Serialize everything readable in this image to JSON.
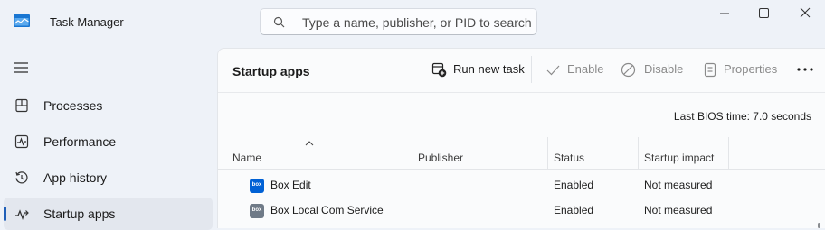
{
  "window": {
    "title": "Task Manager",
    "search_placeholder": "Type a name, publisher, or PID to search",
    "controls": [
      "minimize-icon",
      "maximize-icon",
      "close-icon"
    ]
  },
  "sidebar": {
    "menu_icon": "hamburger-icon",
    "items": [
      {
        "label": "Processes",
        "icon": "processes-icon",
        "selected": false
      },
      {
        "label": "Performance",
        "icon": "performance-icon",
        "selected": false
      },
      {
        "label": "App history",
        "icon": "history-icon",
        "selected": false
      },
      {
        "label": "Startup apps",
        "icon": "startup-icon",
        "selected": true
      }
    ]
  },
  "main": {
    "title": "Startup apps",
    "toolbar": {
      "run_new_task": "Run new task",
      "enable": "Enable",
      "disable": "Disable",
      "properties": "Properties",
      "more": "more-options-icon"
    },
    "bios_time": "Last BIOS time:  7.0 seconds",
    "columns": [
      "Name",
      "Publisher",
      "Status",
      "Startup impact"
    ],
    "sort": {
      "column": "Name",
      "direction": "ascending"
    },
    "rows": [
      {
        "name": "Box Edit",
        "publisher": "",
        "status": "Enabled",
        "impact": "Not measured",
        "icon_text": "box",
        "icon_color": "#0061d5"
      },
      {
        "name": "Box Local Com Service",
        "publisher": "",
        "status": "Enabled",
        "impact": "Not measured",
        "icon_text": "box",
        "icon_color": "#6f7a87"
      }
    ]
  },
  "colors": {
    "accent": "#1f5fb8",
    "background": "#eef2f8",
    "panel": "#fafbfc",
    "disabled_text": "#8a8a8a"
  }
}
